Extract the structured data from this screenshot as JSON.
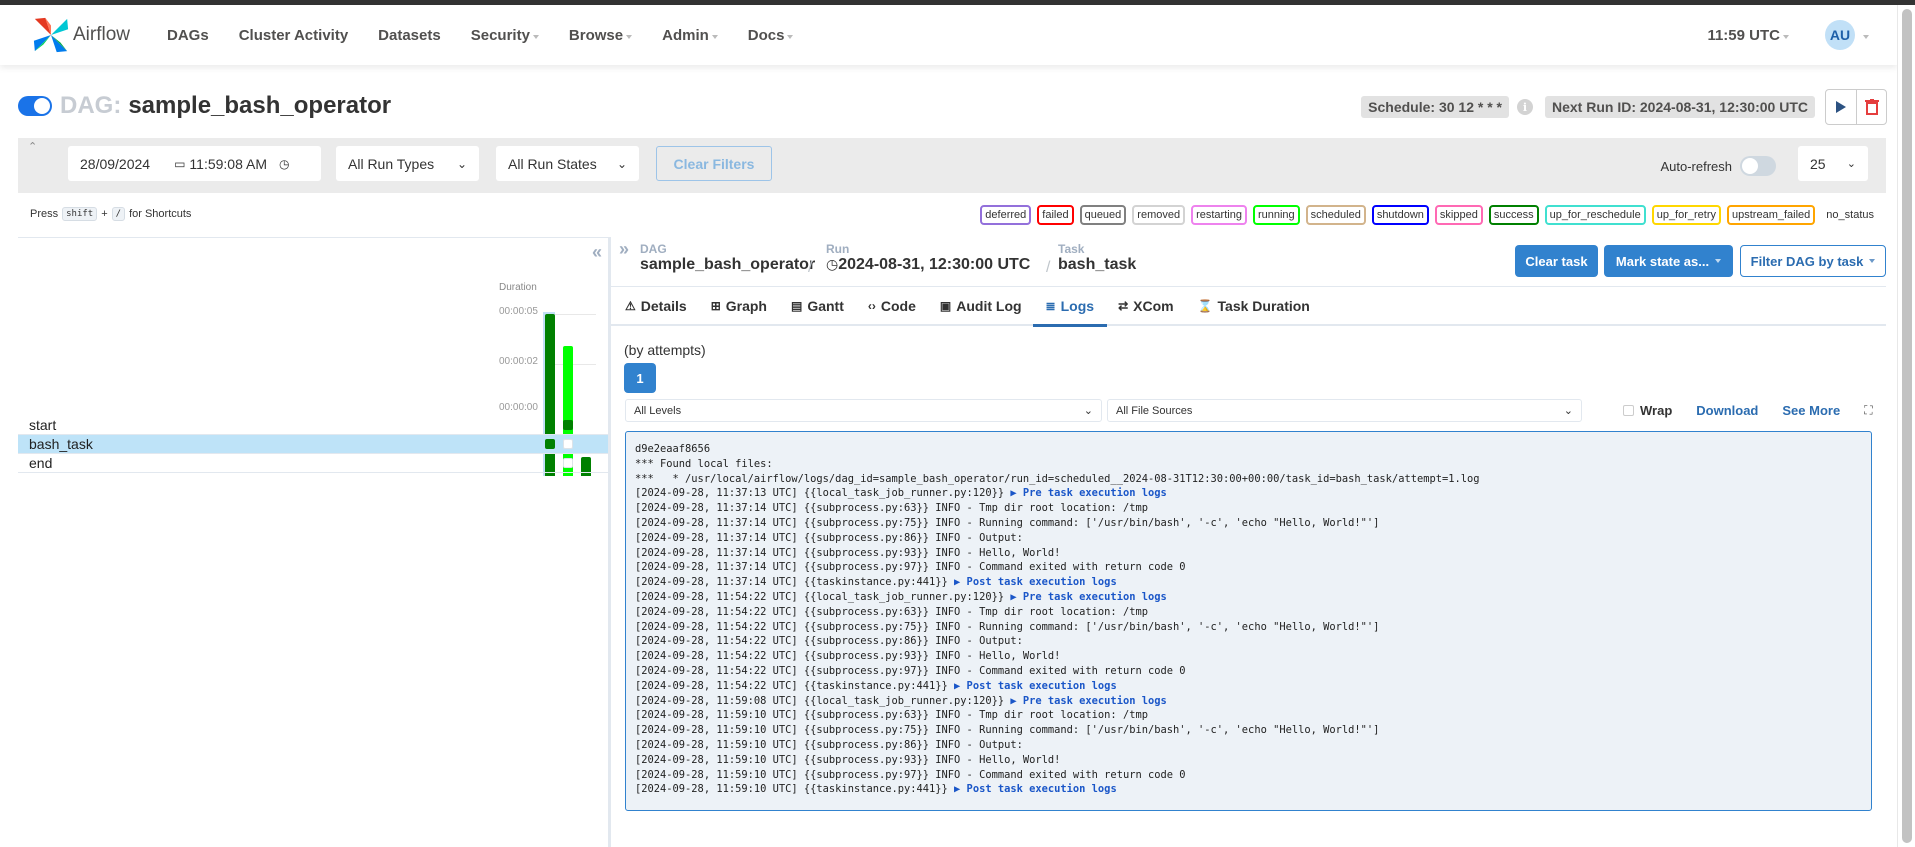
{
  "navbar": {
    "brand": "Airflow",
    "items": [
      {
        "label": "DAGs",
        "dropdown": false
      },
      {
        "label": "Cluster Activity",
        "dropdown": false
      },
      {
        "label": "Datasets",
        "dropdown": false
      },
      {
        "label": "Security",
        "dropdown": true
      },
      {
        "label": "Browse",
        "dropdown": true
      },
      {
        "label": "Admin",
        "dropdown": true
      },
      {
        "label": "Docs",
        "dropdown": true
      }
    ],
    "clock": "11:59 UTC",
    "avatar_initials": "AU"
  },
  "dag": {
    "prefix": "DAG:",
    "name": "sample_bash_operator",
    "paused": false,
    "schedule": "Schedule: 30 12 * * *",
    "info_icon": "i",
    "next_run": "Next Run ID: 2024-08-31, 12:30:00 UTC"
  },
  "filters": {
    "date": "28/09/2024",
    "time": "11:59:08 AM",
    "run_types": "All Run Types",
    "run_states": "All Run States",
    "clear_label": "Clear Filters",
    "auto_refresh_label": "Auto-refresh",
    "auto_refresh_on": false,
    "page_size": "25"
  },
  "shortcuts": {
    "press": "Press",
    "key1": "shift",
    "plus": "+",
    "key2": "/",
    "suffix": "for Shortcuts"
  },
  "legend": [
    {
      "label": "deferred",
      "color": "#9370db"
    },
    {
      "label": "failed",
      "color": "#ff0000"
    },
    {
      "label": "queued",
      "color": "#808080"
    },
    {
      "label": "removed",
      "color": "#d3d3d3"
    },
    {
      "label": "restarting",
      "color": "#ee82ee"
    },
    {
      "label": "running",
      "color": "#00ff00"
    },
    {
      "label": "scheduled",
      "color": "#d2b48c"
    },
    {
      "label": "shutdown",
      "color": "#0000ff"
    },
    {
      "label": "skipped",
      "color": "#ff69b4"
    },
    {
      "label": "success",
      "color": "#008000"
    },
    {
      "label": "up_for_reschedule",
      "color": "#40e0d0"
    },
    {
      "label": "up_for_retry",
      "color": "#ffd700"
    },
    {
      "label": "upstream_failed",
      "color": "#ffa500"
    },
    {
      "label": "no_status",
      "color": ""
    }
  ],
  "grid": {
    "duration_label": "Duration",
    "ticks": [
      "00:00:05",
      "00:00:02",
      "00:00:00"
    ],
    "runs": [
      {
        "state": "success",
        "color": "#008000",
        "duration_fraction": 1.0,
        "selected": true
      },
      {
        "state": "running",
        "color": "#00ff00",
        "duration_fraction": 0.8,
        "selected": false
      },
      {
        "state": "success",
        "color": "#008000",
        "duration_fraction": 0.12,
        "selected": false
      }
    ],
    "tasks": [
      {
        "name": "start",
        "states": [
          "#008000",
          "#008000",
          null
        ],
        "selected": false
      },
      {
        "name": "bash_task",
        "states": [
          "#008000",
          "none",
          null
        ],
        "selected": true
      },
      {
        "name": "end",
        "states": [
          "#008000",
          "none",
          null
        ],
        "selected": false
      }
    ]
  },
  "detail": {
    "breadcrumb": {
      "dag_label": "DAG",
      "dag_value": "sample_bash_operator",
      "run_label": "Run",
      "run_value": "2024-08-31, 12:30:00 UTC",
      "task_label": "Task",
      "task_value": "bash_task",
      "sep": "/"
    },
    "actions": {
      "clear": "Clear task",
      "mark": "Mark state as...",
      "filter": "Filter DAG by task"
    },
    "tabs": [
      {
        "label": "Details",
        "icon": "⚠",
        "active": false
      },
      {
        "label": "Graph",
        "icon": "⊞",
        "active": false
      },
      {
        "label": "Gantt",
        "icon": "▤",
        "active": false
      },
      {
        "label": "Code",
        "icon": "‹›",
        "active": false
      },
      {
        "label": "Audit Log",
        "icon": "▣",
        "active": false
      },
      {
        "label": "Logs",
        "icon": "≣",
        "active": true
      },
      {
        "label": "XCom",
        "icon": "⇄",
        "active": false
      },
      {
        "label": "Task Duration",
        "icon": "⌛",
        "active": false
      }
    ]
  },
  "logs": {
    "attempts_label": "(by attempts)",
    "attempt": "1",
    "level_select": "All Levels",
    "source_select": "All File Sources",
    "wrap_label": "Wrap",
    "download_label": "Download",
    "see_more_label": "See More",
    "lines": [
      {
        "text": "d9e2eaaf8656",
        "link": ""
      },
      {
        "text": "*** Found local files:",
        "link": ""
      },
      {
        "text": "***   * /usr/local/airflow/logs/dag_id=sample_bash_operator/run_id=scheduled__2024-08-31T12:30:00+00:00/task_id=bash_task/attempt=1.log",
        "link": ""
      },
      {
        "text": "[2024-09-28, 11:37:13 UTC] {{local_task_job_runner.py:120}} ",
        "link": "▶ Pre task execution logs"
      },
      {
        "text": "[2024-09-28, 11:37:14 UTC] {{subprocess.py:63}} INFO - Tmp dir root location: /tmp",
        "link": ""
      },
      {
        "text": "[2024-09-28, 11:37:14 UTC] {{subprocess.py:75}} INFO - Running command: ['/usr/bin/bash', '-c', 'echo \"Hello, World!\"']",
        "link": ""
      },
      {
        "text": "[2024-09-28, 11:37:14 UTC] {{subprocess.py:86}} INFO - Output:",
        "link": ""
      },
      {
        "text": "[2024-09-28, 11:37:14 UTC] {{subprocess.py:93}} INFO - Hello, World!",
        "link": ""
      },
      {
        "text": "[2024-09-28, 11:37:14 UTC] {{subprocess.py:97}} INFO - Command exited with return code 0",
        "link": ""
      },
      {
        "text": "[2024-09-28, 11:37:14 UTC] {{taskinstance.py:441}} ",
        "link": "▶ Post task execution logs"
      },
      {
        "text": "[2024-09-28, 11:54:22 UTC] {{local_task_job_runner.py:120}} ",
        "link": "▶ Pre task execution logs"
      },
      {
        "text": "[2024-09-28, 11:54:22 UTC] {{subprocess.py:63}} INFO - Tmp dir root location: /tmp",
        "link": ""
      },
      {
        "text": "[2024-09-28, 11:54:22 UTC] {{subprocess.py:75}} INFO - Running command: ['/usr/bin/bash', '-c', 'echo \"Hello, World!\"']",
        "link": ""
      },
      {
        "text": "[2024-09-28, 11:54:22 UTC] {{subprocess.py:86}} INFO - Output:",
        "link": ""
      },
      {
        "text": "[2024-09-28, 11:54:22 UTC] {{subprocess.py:93}} INFO - Hello, World!",
        "link": ""
      },
      {
        "text": "[2024-09-28, 11:54:22 UTC] {{subprocess.py:97}} INFO - Command exited with return code 0",
        "link": ""
      },
      {
        "text": "[2024-09-28, 11:54:22 UTC] {{taskinstance.py:441}} ",
        "link": "▶ Post task execution logs"
      },
      {
        "text": "[2024-09-28, 11:59:08 UTC] {{local_task_job_runner.py:120}} ",
        "link": "▶ Pre task execution logs"
      },
      {
        "text": "[2024-09-28, 11:59:10 UTC] {{subprocess.py:63}} INFO - Tmp dir root location: /tmp",
        "link": ""
      },
      {
        "text": "[2024-09-28, 11:59:10 UTC] {{subprocess.py:75}} INFO - Running command: ['/usr/bin/bash', '-c', 'echo \"Hello, World!\"']",
        "link": ""
      },
      {
        "text": "[2024-09-28, 11:59:10 UTC] {{subprocess.py:86}} INFO - Output:",
        "link": ""
      },
      {
        "text": "[2024-09-28, 11:59:10 UTC] {{subprocess.py:93}} INFO - Hello, World!",
        "link": ""
      },
      {
        "text": "[2024-09-28, 11:59:10 UTC] {{subprocess.py:97}} INFO - Command exited with return code 0",
        "link": ""
      },
      {
        "text": "[2024-09-28, 11:59:10 UTC] {{taskinstance.py:441}} ",
        "link": "▶ Post task execution logs"
      }
    ]
  }
}
